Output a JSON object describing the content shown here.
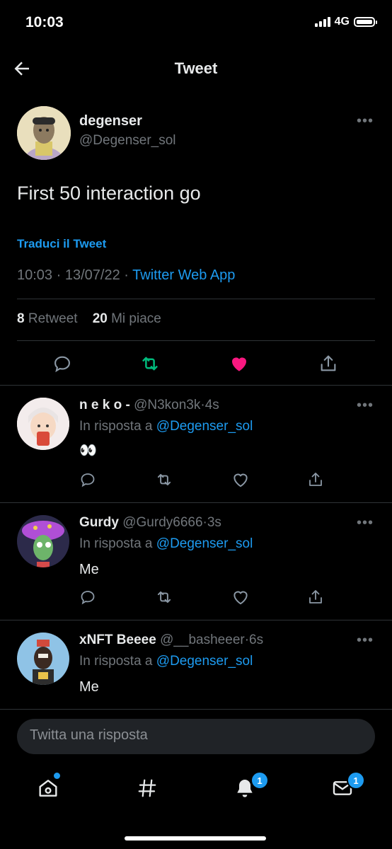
{
  "status_bar": {
    "time": "10:03",
    "network": "4G"
  },
  "header": {
    "title": "Tweet",
    "back_icon": "arrow-left-icon"
  },
  "tweet": {
    "name": "degenser",
    "handle": "@Degenser_sol",
    "text": "First 50 interaction go",
    "translate": "Traduci il Tweet",
    "time": "10:03",
    "date": "13/07/22",
    "source": "Twitter Web App",
    "retweets": "8",
    "retweets_label": "Retweet",
    "likes": "20",
    "likes_label": "Mi piace",
    "more": "•••"
  },
  "colors": {
    "accent": "#1d9bf0",
    "retweet": "#00ba7c",
    "like": "#f91880"
  },
  "replies": [
    {
      "name": "n e k o -",
      "handle": "@N3kon3k",
      "age": "4s",
      "reply_prefix": "In risposta a",
      "reply_to": "@Degenser_sol",
      "text": "👀"
    },
    {
      "name": "Gurdy",
      "handle": "@Gurdy6666",
      "age": "3s",
      "reply_prefix": "In risposta a",
      "reply_to": "@Degenser_sol",
      "text": "Me"
    },
    {
      "name": "xNFT Beeee",
      "handle": "@__basheeer",
      "age": "6s",
      "reply_prefix": "In risposta a",
      "reply_to": "@Degenser_sol",
      "text": "Me"
    }
  ],
  "compose": {
    "placeholder": "Twitta una risposta"
  },
  "tabbar": {
    "notifications_badge": "1",
    "messages_badge": "1"
  },
  "separator": "·"
}
